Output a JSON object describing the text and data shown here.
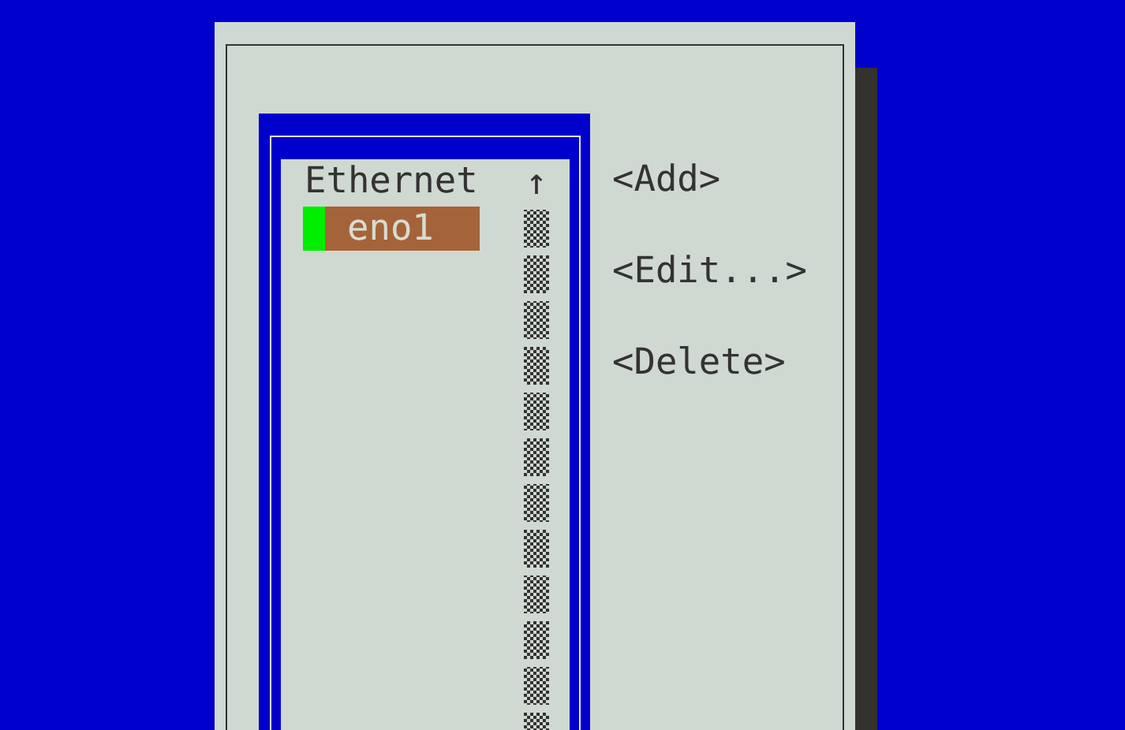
{
  "connection_list": {
    "groups": [
      {
        "label": "Ethernet",
        "items": [
          {
            "name": "eno1",
            "selected": true
          }
        ]
      }
    ],
    "scroll_up": "↑"
  },
  "buttons": [
    "<Add>",
    "<Edit...>",
    "<Delete>"
  ]
}
